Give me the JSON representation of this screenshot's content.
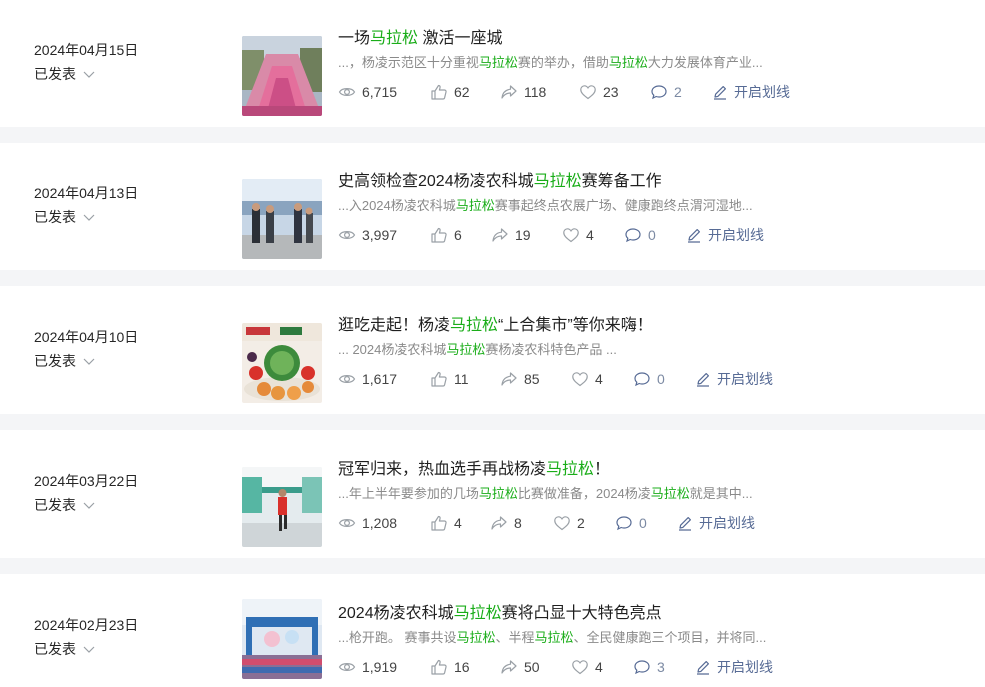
{
  "highlight_color": "#1aad19",
  "articles": [
    {
      "date": "2024年04月15日",
      "status": "已发表",
      "title": [
        {
          "t": "一场",
          "hl": false
        },
        {
          "t": "马拉松",
          "hl": true
        },
        {
          "t": " 激活一座城",
          "hl": false
        }
      ],
      "excerpt": [
        {
          "t": "...，杨凌示范区十分重视",
          "hl": false
        },
        {
          "t": "马拉松",
          "hl": true
        },
        {
          "t": "赛的举办，借助",
          "hl": false
        },
        {
          "t": "马拉松",
          "hl": true
        },
        {
          "t": "大力发展体育产业...",
          "hl": false
        }
      ],
      "views": "6,715",
      "likes": "62",
      "shares": "118",
      "favs": "23",
      "comments": "2",
      "mark_label": "开启划线",
      "thumb_icon": "marathon-crowd-photo"
    },
    {
      "date": "2024年04月13日",
      "status": "已发表",
      "title": [
        {
          "t": "史高领检查2024杨凌农科城",
          "hl": false
        },
        {
          "t": "马拉松",
          "hl": true
        },
        {
          "t": "赛筹备工作",
          "hl": false
        }
      ],
      "excerpt": [
        {
          "t": "...入2024杨凌农科城",
          "hl": false
        },
        {
          "t": "马拉松",
          "hl": true
        },
        {
          "t": "赛事起终点农展广场、健康跑终点渭河湿地...",
          "hl": false
        }
      ],
      "views": "3,997",
      "likes": "6",
      "shares": "19",
      "favs": "4",
      "comments": "0",
      "mark_label": "开启划线",
      "thumb_icon": "officials-inspection-photo"
    },
    {
      "date": "2024年04月10日",
      "status": "已发表",
      "title": [
        {
          "t": "逛吃走起！杨凌",
          "hl": false
        },
        {
          "t": "马拉松",
          "hl": true
        },
        {
          "t": "“上合集市”等你来嗨！",
          "hl": false
        }
      ],
      "excerpt": [
        {
          "t": "... 2024杨凌农科城",
          "hl": false
        },
        {
          "t": "马拉松",
          "hl": true
        },
        {
          "t": "赛杨凌农科特色产品 ...",
          "hl": false
        }
      ],
      "views": "1,617",
      "likes": "11",
      "shares": "85",
      "favs": "4",
      "comments": "0",
      "mark_label": "开启划线",
      "thumb_icon": "fruit-platter-photo"
    },
    {
      "date": "2024年03月22日",
      "status": "已发表",
      "title": [
        {
          "t": "冠军归来，热血选手再战杨凌",
          "hl": false
        },
        {
          "t": "马拉松",
          "hl": true
        },
        {
          "t": "！",
          "hl": false
        }
      ],
      "excerpt": [
        {
          "t": "...年上半年要参加的几场",
          "hl": false
        },
        {
          "t": "马拉松",
          "hl": true
        },
        {
          "t": "比赛做准备，2024杨凌",
          "hl": false
        },
        {
          "t": "马拉松",
          "hl": true
        },
        {
          "t": "就是其中...",
          "hl": false
        }
      ],
      "views": "1,208",
      "likes": "4",
      "shares": "8",
      "favs": "2",
      "comments": "0",
      "mark_label": "开启划线",
      "thumb_icon": "runner-finish-photo"
    },
    {
      "date": "2024年02月23日",
      "status": "已发表",
      "title": [
        {
          "t": "2024杨凌农科城",
          "hl": false
        },
        {
          "t": "马拉松",
          "hl": true
        },
        {
          "t": "赛将凸显十大特色亮点",
          "hl": false
        }
      ],
      "excerpt": [
        {
          "t": "...枪开跑。 赛事共设",
          "hl": false
        },
        {
          "t": "马拉松",
          "hl": true
        },
        {
          "t": "、半程",
          "hl": false
        },
        {
          "t": "马拉松",
          "hl": true
        },
        {
          "t": "、全民健康跑三个项目，并将同...",
          "hl": false
        }
      ],
      "views": "1,919",
      "likes": "16",
      "shares": "50",
      "favs": "4",
      "comments": "3",
      "mark_label": "开启划线",
      "thumb_icon": "race-start-photo"
    }
  ]
}
